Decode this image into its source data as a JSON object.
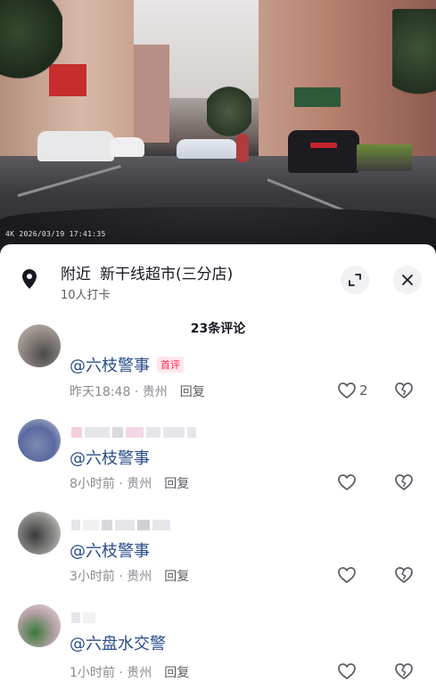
{
  "video": {
    "timestamp": "4K 2026/03/19 17:41:35"
  },
  "location": {
    "prefix": "附近",
    "name": "新干线超市(三分店)",
    "checkins": "10人打卡"
  },
  "comments_header": {
    "count_label": "23条评论"
  },
  "comments": [
    {
      "text": "@六枝警事",
      "badge": "首评",
      "time": "昨天18:48",
      "region": "贵州",
      "reply": "回复",
      "likes": "2"
    },
    {
      "text": "@六枝警事",
      "badge": "",
      "time": "8小时前",
      "region": "贵州",
      "reply": "回复",
      "likes": ""
    },
    {
      "text": "@六枝警事",
      "badge": "",
      "time": "3小时前",
      "region": "贵州",
      "reply": "回复",
      "likes": ""
    },
    {
      "text": "@六盘水交警",
      "badge": "",
      "time": "1小时前",
      "region": "贵州",
      "reply": "回复",
      "likes": ""
    }
  ],
  "icons": {
    "location": "location-pin-icon",
    "expand": "expand-icon",
    "close": "close-icon",
    "like": "heart-outline-icon",
    "dislike": "broken-heart-icon"
  },
  "colors": {
    "mention": "#2a4d8a",
    "badge": "#fe2c55",
    "meta": "#8a8b91"
  }
}
